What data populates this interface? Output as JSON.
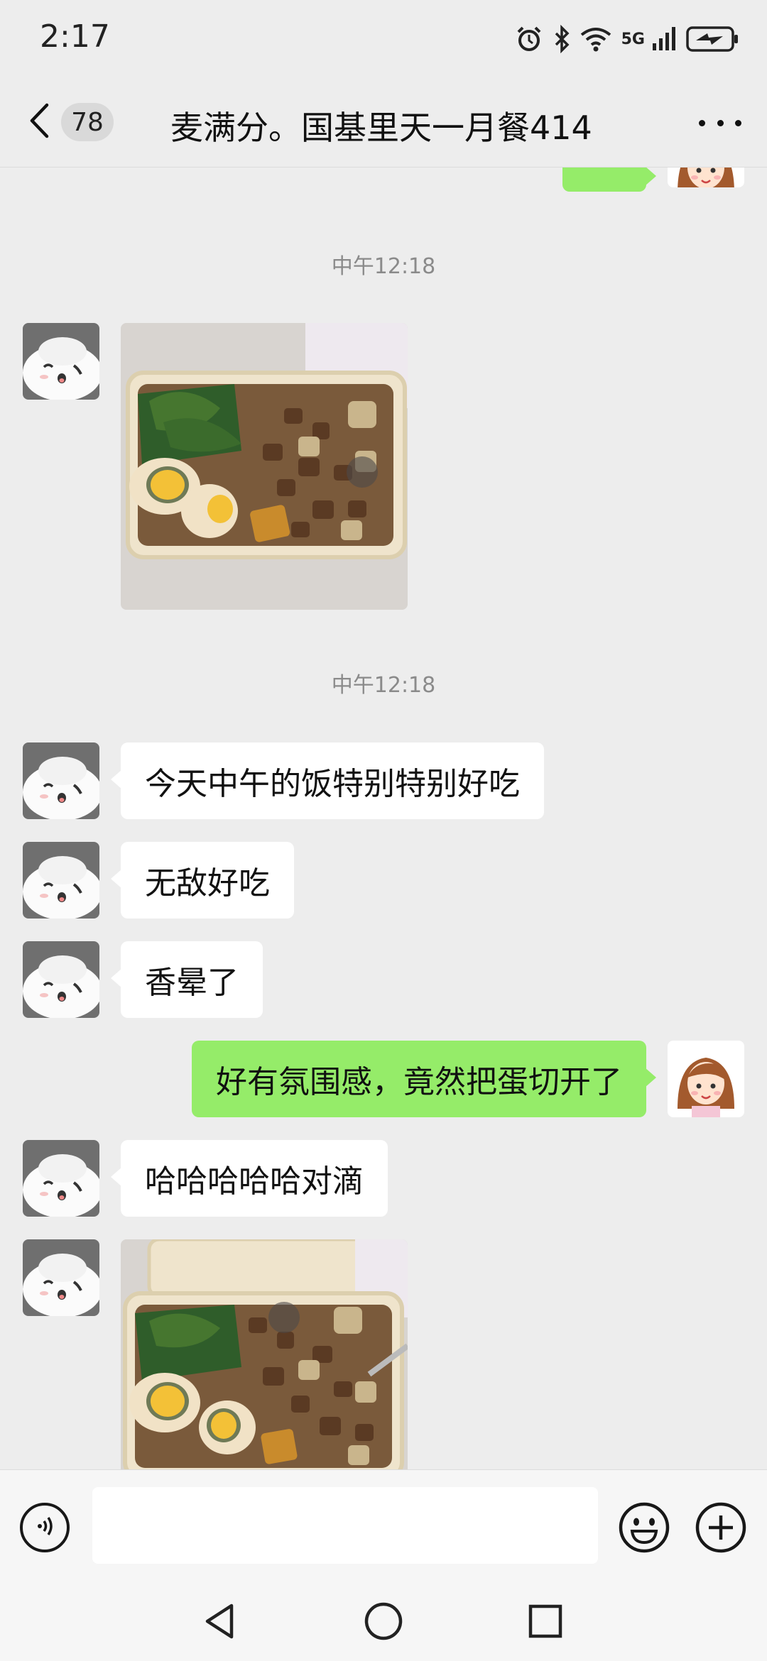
{
  "status_bar": {
    "time": "2:17",
    "network": "5G",
    "icons": [
      "alarm-icon",
      "bluetooth-icon",
      "wifi-icon",
      "signal-icon",
      "battery-charging-icon"
    ]
  },
  "header": {
    "unread_count": "78",
    "title": "麦满分。国基里天一月餐414",
    "back_icon": "chevron-left-icon",
    "more_icon": "more-dots-icon"
  },
  "messages": [
    {
      "type": "timestamp",
      "text": "中午12:18"
    },
    {
      "type": "image",
      "sender": "other",
      "description": "photo"
    },
    {
      "type": "timestamp",
      "text": "中午12:18"
    },
    {
      "type": "text",
      "sender": "other",
      "text": "今天中午的饭特别特别好吃"
    },
    {
      "type": "text",
      "sender": "other",
      "text": "无敌好吃"
    },
    {
      "type": "text",
      "sender": "other",
      "text": "香晕了"
    },
    {
      "type": "text",
      "sender": "self",
      "text": "好有氛围感，竟然把蛋切开了"
    },
    {
      "type": "text",
      "sender": "other",
      "text": "哈哈哈哈哈对滴"
    },
    {
      "type": "image",
      "sender": "other",
      "description": "photo"
    }
  ],
  "input_bar": {
    "value": "",
    "placeholder": "",
    "icons": [
      "voice-icon",
      "emoji-icon",
      "plus-icon"
    ]
  },
  "nav_bar": {
    "icons": [
      "back-triangle-icon",
      "home-circle-icon",
      "recents-square-icon"
    ]
  },
  "colors": {
    "background": "#ededed",
    "bubble_self": "#95ec69",
    "bubble_other": "#ffffff",
    "timestamp_text": "#8a8a8a"
  }
}
